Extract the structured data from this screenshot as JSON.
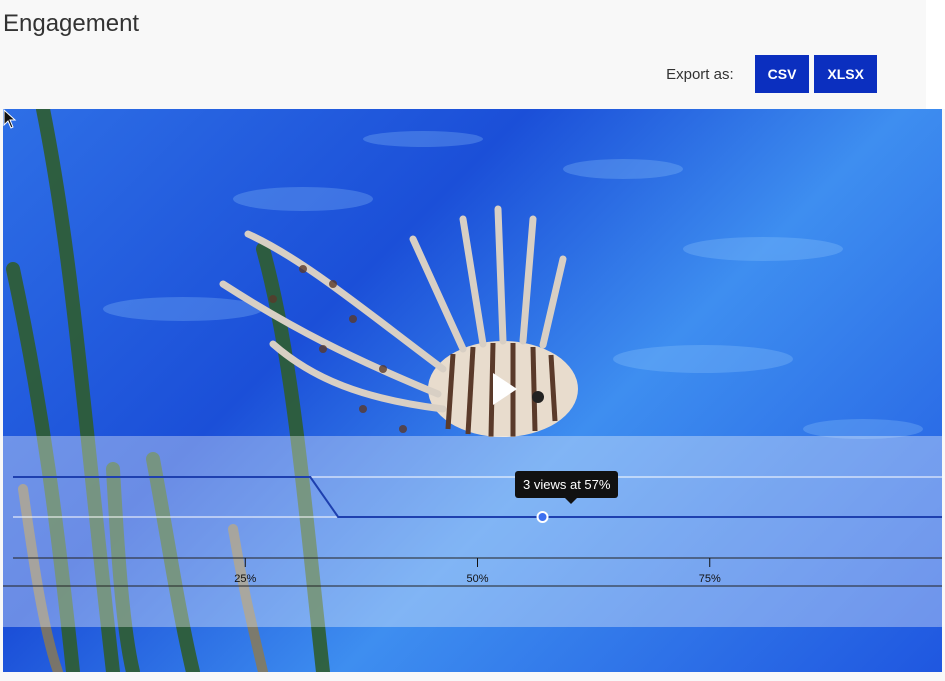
{
  "page": {
    "title": "Engagement"
  },
  "export": {
    "label": "Export as:",
    "buttons": [
      "CSV",
      "XLSX"
    ]
  },
  "player": {
    "play_icon": "play-icon"
  },
  "tooltip": {
    "text": "3 views at 57%"
  },
  "chart_data": {
    "type": "line",
    "x": [
      0,
      32,
      35,
      57,
      100
    ],
    "series": [
      {
        "values": [
          4,
          4,
          3,
          3,
          3
        ]
      }
    ],
    "ticks": [
      "25%",
      "50%",
      "75%"
    ],
    "tick_values": [
      25,
      50,
      75
    ],
    "hover": {
      "x": 57,
      "y": 3
    },
    "xlim": [
      0,
      100
    ]
  },
  "colors": {
    "accent": "#0b2fbf",
    "line": "#1e40af"
  }
}
